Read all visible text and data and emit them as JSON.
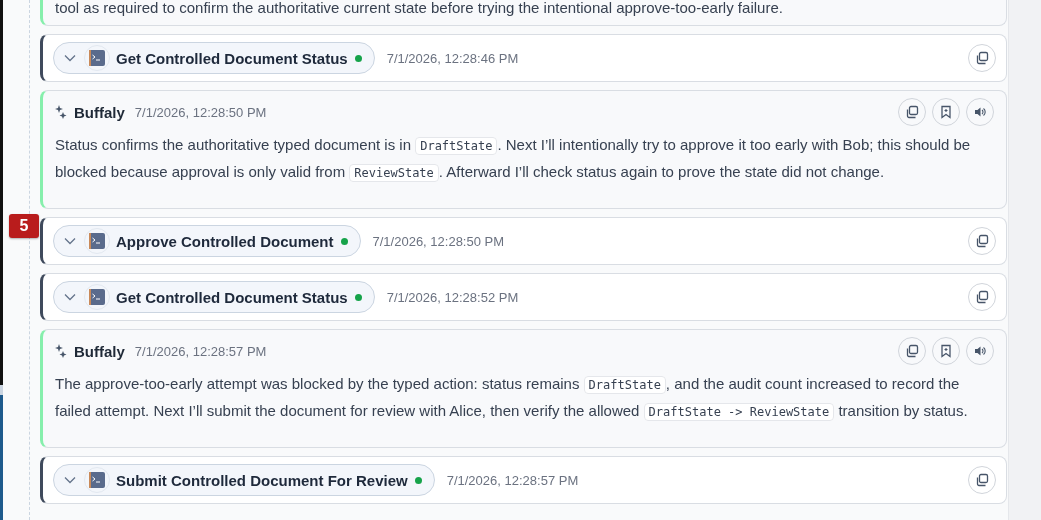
{
  "items": [
    {
      "kind": "message_tail",
      "segments": [
        {
          "text": "tool as required to confirm the authoritative current state before trying the intentional approve-too-early failure."
        }
      ]
    },
    {
      "kind": "tool",
      "title": "Get Controlled Document Status",
      "color": "#16a34a",
      "expanded": false,
      "time": "7/1/2026, 12:28:46 PM"
    },
    {
      "kind": "message",
      "author": "Buffaly",
      "time": "7/1/2026, 12:28:50 PM",
      "segments": [
        {
          "text": "Status confirms the authoritative typed document is in "
        },
        {
          "code": "DraftState"
        },
        {
          "text": ". Next I’ll intentionally try to approve it too early with Bob; this should be blocked because approval is only valid from "
        },
        {
          "code": "ReviewState"
        },
        {
          "text": ". Afterward I’ll check status again to prove the state did not change."
        }
      ]
    },
    {
      "kind": "tool",
      "step_badge": "5",
      "title": "Approve Controlled Document",
      "color": "#16a34a",
      "expanded": false,
      "time": "7/1/2026, 12:28:50 PM"
    },
    {
      "kind": "tool",
      "title": "Get Controlled Document Status",
      "color": "#16a34a",
      "expanded": false,
      "time": "7/1/2026, 12:28:52 PM"
    },
    {
      "kind": "message",
      "author": "Buffaly",
      "time": "7/1/2026, 12:28:57 PM",
      "segments": [
        {
          "text": "The approve-too-early attempt was blocked by the typed action: status remains "
        },
        {
          "code": "DraftState"
        },
        {
          "text": ", and the audit count increased to record the failed attempt. Next I’ll submit the document for review with Alice, then verify the allowed "
        },
        {
          "code": "DraftState -> ReviewState"
        },
        {
          "text": " transition by status."
        }
      ]
    },
    {
      "kind": "tool",
      "title": "Submit Controlled Document For Review",
      "color": "#16a34a",
      "expanded": false,
      "time": "7/1/2026, 12:28:57 PM"
    }
  ]
}
